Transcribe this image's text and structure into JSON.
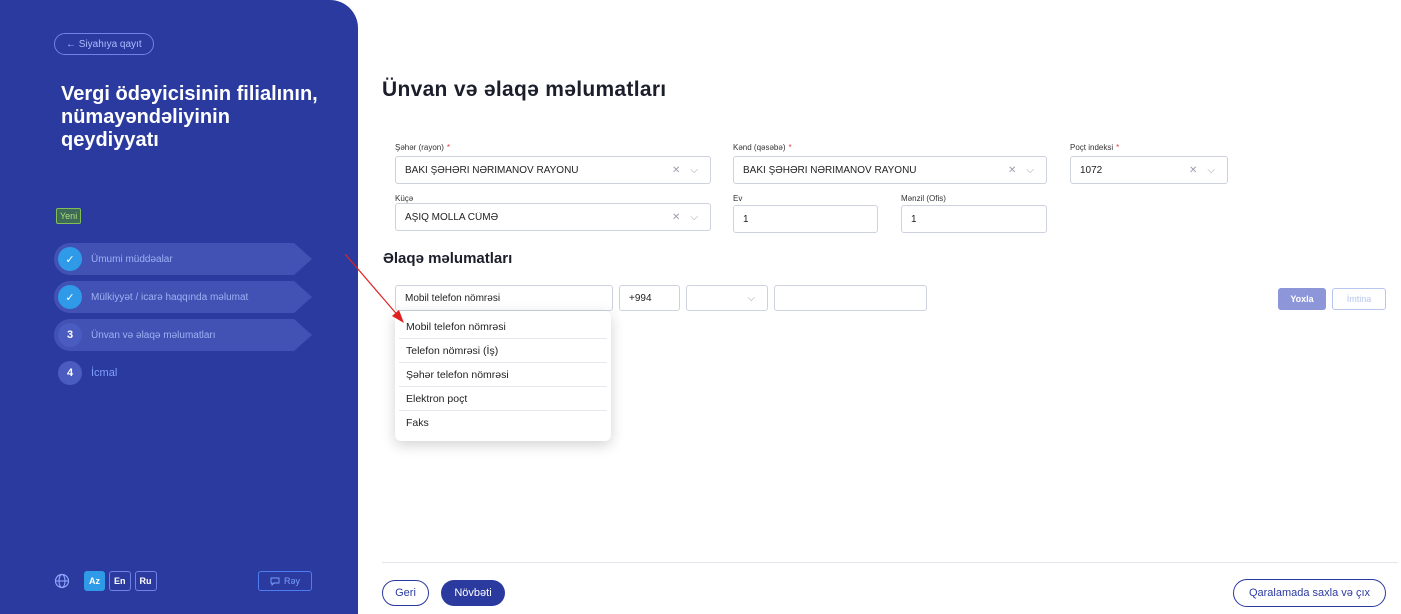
{
  "sidebar": {
    "back_label": "← Siyahıya qayıt",
    "title": "Vergi ödəyicisinin filialının, nümayəndəliyinin qeydiyyatı",
    "status_badge": "Yeni",
    "steps": [
      {
        "marker": "✓",
        "label": "Ümumi müddəalar"
      },
      {
        "marker": "✓",
        "label": "Mülkiyyət / icarə haqqında məlumat"
      },
      {
        "marker": "3",
        "label": "Ünvan və əlaqə məlumatları"
      },
      {
        "marker": "4",
        "label": "İcmal"
      }
    ],
    "languages": [
      "Az",
      "En",
      "Ru"
    ],
    "active_language": "Az",
    "feedback_label": "Rəy"
  },
  "main": {
    "title": "Ünvan və əlaqə məlumatları",
    "address": {
      "city_label": "Şəhər (rayon)",
      "city_value": "BAKI ŞƏHƏRİ NƏRİMANOV RAYONU",
      "village_label": "Kənd (qəsəbə)",
      "village_value": "BAKI ŞƏHƏRİ NƏRİMANOV RAYONU",
      "postal_label": "Poçt indeksi",
      "postal_value": "1072",
      "street_label": "Küçə",
      "street_value": "AŞIQ MOLLA CÜMƏ",
      "house_label": "Ev",
      "house_value": "1",
      "apartment_label": "Mənzil (Ofis)",
      "apartment_value": "1"
    },
    "contact": {
      "title": "Əlaqə məlumatları",
      "type_value": "Mobil telefon nömrəsi",
      "country_code": "+994",
      "operator_value": "",
      "number_value": "",
      "options": [
        "Mobil telefon nömrəsi",
        "Telefon nömrəsi (İş)",
        "Şəhər telefon nömrəsi",
        "Elektron poçt",
        "Faks"
      ],
      "check_label": "Yoxla",
      "cancel_label": "İmtina"
    },
    "footer": {
      "back_label": "Geri",
      "next_label": "Növbəti",
      "save_draft_label": "Qaralamada saxla və çıx"
    },
    "colors": {
      "primary": "#2b3a9e",
      "accent": "#2f9be8",
      "required": "#e23b3b"
    }
  }
}
